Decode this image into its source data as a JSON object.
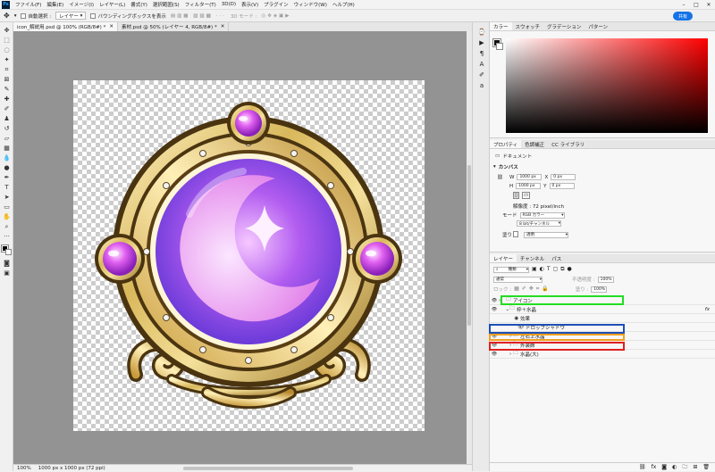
{
  "app": {
    "logo": "Ps"
  },
  "menu": [
    "ファイル(F)",
    "編集(E)",
    "イメージ(I)",
    "レイヤー(L)",
    "書式(Y)",
    "選択範囲(S)",
    "フィルター(T)",
    "3D(D)",
    "表示(V)",
    "プラグイン",
    "ウィンドウ(W)",
    "ヘルプ(H)"
  ],
  "options": {
    "auto_select": "自動選択 :",
    "layer_select": "レイヤー",
    "transform_controls": "バウンディングボックスを表示",
    "mode_3d": "3D モード :",
    "share": "共有"
  },
  "tabs": [
    {
      "label": "icon_解説用.psd @ 100% (RGB/8#) *",
      "active": true
    },
    {
      "label": "素材.psd @ 50% (レイヤー 4, RGB/8#) *",
      "active": false
    }
  ],
  "status": {
    "zoom": "100%",
    "doc_size": "1000 px x 1000 px (72 ppi)"
  },
  "colors": {
    "accent": "#1473e6",
    "highlight_green": "#22dd22",
    "highlight_blue": "#1f4fb5",
    "highlight_orange": "#f0a020",
    "highlight_red": "#e02020"
  },
  "color_panel": {
    "tabs": [
      "カラー",
      "スウォッチ",
      "グラデーション",
      "パターン"
    ]
  },
  "properties": {
    "tabs": [
      "プロパティ",
      "色調補正",
      "CC ライブラリ"
    ],
    "doc_label": "ドキュメント",
    "section": "カンバス",
    "w_label": "W",
    "w_value": "1000 px",
    "x_label": "X",
    "x_value": "0 px",
    "h_label": "H",
    "h_value": "1000 px",
    "y_label": "Y",
    "y_value": "0 px",
    "resolution": "解像度 : 72 pixel/inch",
    "mode_label": "モード",
    "mode_value": "RGB カラー",
    "bit_value": "8 bit/チャンネル",
    "fill_label": "塗り",
    "fill_value": "透明"
  },
  "layers": {
    "tabs": [
      "レイヤー",
      "チャンネル",
      "パス"
    ],
    "kind": "種類",
    "blend": "通常",
    "opacity_label": "不透明度 :",
    "opacity_value": "100%",
    "lock_label": "ロック :",
    "fill_label": "塗り :",
    "fill_value": "100%",
    "fx": "fx",
    "items": [
      {
        "name": "アイコン",
        "indent": 0,
        "type": "group"
      },
      {
        "name": "枠＋水晶",
        "indent": 1,
        "type": "group"
      },
      {
        "name": "効果",
        "indent": 2,
        "type": "effect"
      },
      {
        "name": "ドロップシャドウ",
        "indent": 3,
        "type": "effect"
      },
      {
        "name": "左右上水晶",
        "indent": 1,
        "type": "group"
      },
      {
        "name": "外装飾",
        "indent": 1,
        "type": "group"
      },
      {
        "name": "水晶(大)",
        "indent": 1,
        "type": "group"
      }
    ]
  }
}
